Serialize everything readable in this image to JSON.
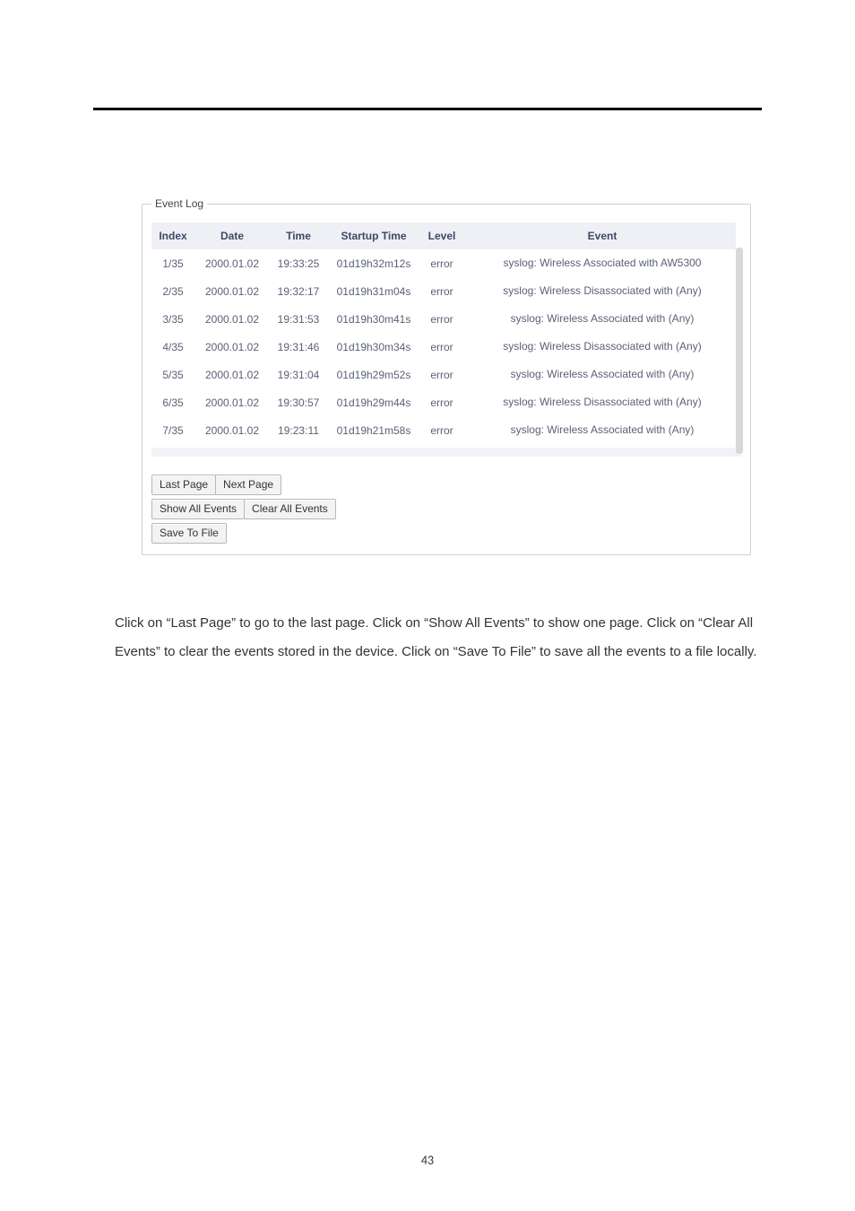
{
  "fieldset_legend": "Event Log",
  "table": {
    "headers": [
      "Index",
      "Date",
      "Time",
      "Startup Time",
      "Level",
      "Event"
    ],
    "rows": [
      {
        "index": "1/35",
        "date": "2000.01.02",
        "time": "19:33:25",
        "startup": "01d19h32m12s",
        "level": "error",
        "event": "syslog: Wireless Associated with AW5300"
      },
      {
        "index": "2/35",
        "date": "2000.01.02",
        "time": "19:32:17",
        "startup": "01d19h31m04s",
        "level": "error",
        "event": "syslog: Wireless Disassociated with (Any)"
      },
      {
        "index": "3/35",
        "date": "2000.01.02",
        "time": "19:31:53",
        "startup": "01d19h30m41s",
        "level": "error",
        "event": "syslog: Wireless Associated with (Any)"
      },
      {
        "index": "4/35",
        "date": "2000.01.02",
        "time": "19:31:46",
        "startup": "01d19h30m34s",
        "level": "error",
        "event": "syslog: Wireless Disassociated with (Any)"
      },
      {
        "index": "5/35",
        "date": "2000.01.02",
        "time": "19:31:04",
        "startup": "01d19h29m52s",
        "level": "error",
        "event": "syslog: Wireless Associated with (Any)"
      },
      {
        "index": "6/35",
        "date": "2000.01.02",
        "time": "19:30:57",
        "startup": "01d19h29m44s",
        "level": "error",
        "event": "syslog: Wireless Disassociated with (Any)"
      },
      {
        "index": "7/35",
        "date": "2000.01.02",
        "time": "19:23:11",
        "startup": "01d19h21m58s",
        "level": "error",
        "event": "syslog: Wireless Associated with (Any)"
      }
    ]
  },
  "buttons": {
    "last_page": "Last Page",
    "next_page": "Next Page",
    "show_all": "Show All Events",
    "clear_all": "Clear All Events",
    "save_file": "Save To File"
  },
  "body_text": "Click on “Last Page” to go to the last page. Click on “Show All Events” to show one page. Click on “Clear All Events” to clear the events stored in the device. Click on “Save To File” to save all the events to a file locally.",
  "page_number": "43"
}
